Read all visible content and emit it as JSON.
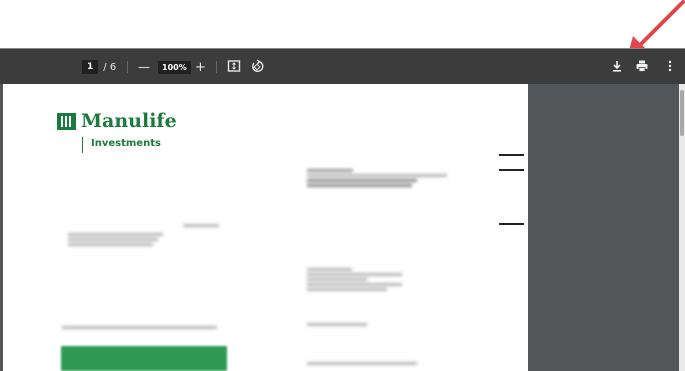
{
  "toolbar": {
    "page_current": "1",
    "page_total": "/ 6",
    "zoom": "100%",
    "zoom_out_label": "—",
    "zoom_in_label": "+",
    "icons": [
      "fit-page-icon",
      "rotate-icon",
      "download-icon",
      "print-icon",
      "more-options-icon"
    ]
  },
  "document": {
    "brand": "Manulife",
    "sub_brand": "Investments",
    "brand_color": "#1b7a3e"
  },
  "colors": {
    "toolbar_bg": "#3c3c3c",
    "viewer_bg": "#525659",
    "annotation_arrow": "#e0474c"
  }
}
